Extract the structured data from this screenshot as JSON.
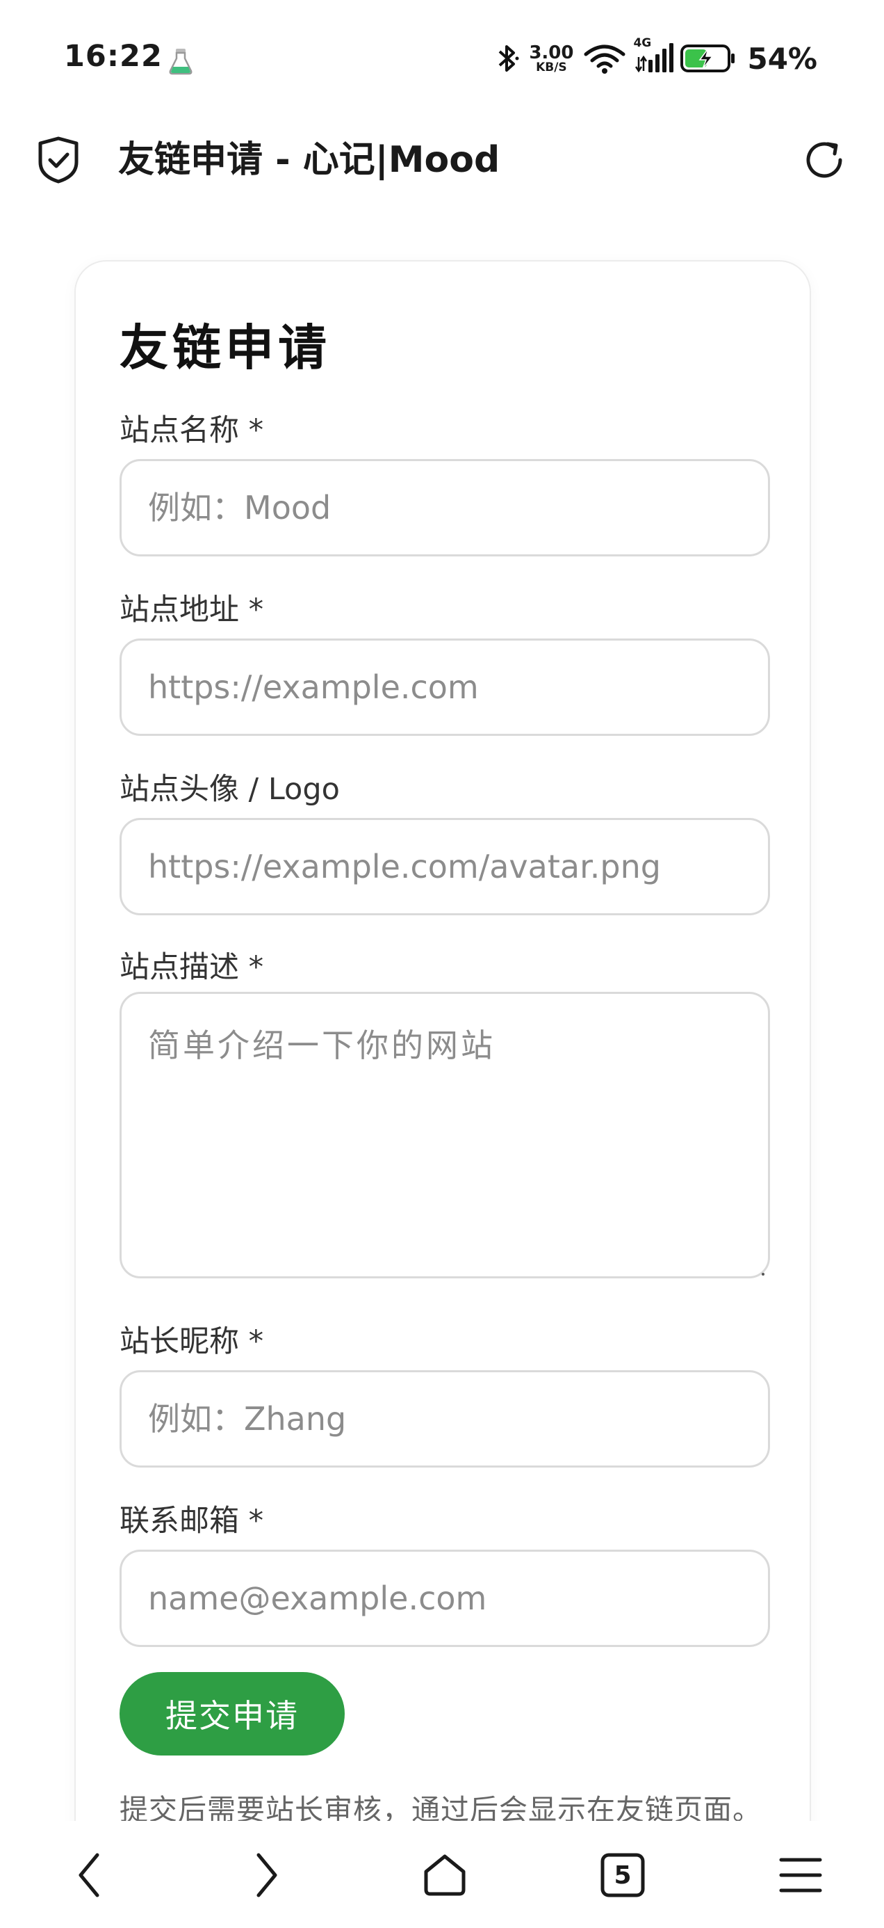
{
  "status_bar": {
    "time": "16:22",
    "app_icon": "flask-icon",
    "bluetooth_icon": "bluetooth-icon",
    "net_speed_value": "3.00",
    "net_speed_unit": "KB/S",
    "wifi_icon": "wifi-icon",
    "cellular_label": "4G",
    "cellular_icon": "signal-icon",
    "battery_icon": "battery-charging-icon",
    "battery_percent": "54%",
    "battery_level": 0.54
  },
  "browser": {
    "page_title": "友链申请 - 心记|Mood",
    "shield_icon": "shield-check-icon",
    "reload_icon": "reload-icon"
  },
  "form": {
    "heading": "友链申请",
    "fields": {
      "site_name": {
        "label": "站点名称 *",
        "placeholder": "例如：Mood",
        "value": ""
      },
      "site_url": {
        "label": "站点地址 *",
        "placeholder": "https://example.com",
        "value": ""
      },
      "site_logo": {
        "label": "站点头像 / Logo",
        "placeholder": "https://example.com/avatar.png",
        "value": ""
      },
      "site_desc": {
        "label": "站点描述 *",
        "placeholder": "简单介绍一下你的网站",
        "value": ""
      },
      "owner_nickname": {
        "label": "站长昵称 *",
        "placeholder": "例如：Zhang",
        "value": ""
      },
      "contact_email": {
        "label": "联系邮箱 *",
        "placeholder": "name@example.com",
        "value": ""
      }
    },
    "submit_label": "提交申请",
    "note": "提交后需要站长审核，通过后会显示在友链页面。",
    "accent_color": "#2e9e44"
  },
  "bottom_nav": {
    "back_icon": "chevron-left-icon",
    "forward_icon": "chevron-right-icon",
    "home_icon": "home-icon",
    "tabs_count": "5",
    "menu_icon": "menu-icon"
  }
}
